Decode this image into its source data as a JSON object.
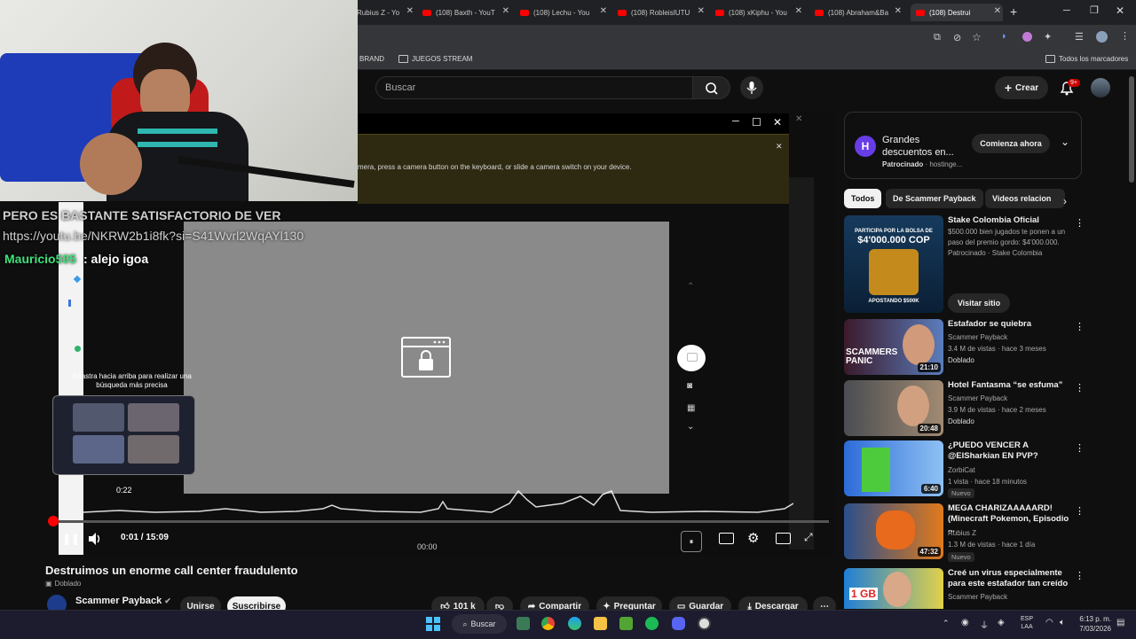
{
  "browser": {
    "tabs": [
      {
        "label": "Rubius Z - Yo",
        "active": false
      },
      {
        "label": "(108) Baxth - YouT",
        "active": false
      },
      {
        "label": "(108) Lechu - You",
        "active": false
      },
      {
        "label": "(108) RobleisIUTU",
        "active": false
      },
      {
        "label": "(108) xKiphu - You",
        "active": false
      },
      {
        "label": "(108) Abraham&Ba",
        "active": false
      },
      {
        "label": "(108) Destrui",
        "active": true
      }
    ],
    "new_tab": "+",
    "bookmarks": [
      {
        "label": "BRAND"
      },
      {
        "label": "JUEGOS STREAM"
      }
    ],
    "all_bookmarks": "Todos los marcadores"
  },
  "youtube_header": {
    "search_placeholder": "Buscar",
    "create_label": "Crear",
    "notif_badge": "9+"
  },
  "chat_overlay": {
    "line1": "PERO ES BASTANTE SATISFACTORIO DE VER",
    "line2": "https://youtu.be/NKRW2b1i8fk?si=S41Wvrl2WqAYl130",
    "user": "Mauricio505",
    "message": ": alejo igoa"
  },
  "player": {
    "camera_hint": "mera, press a camera button on the keyboard, or slide a camera switch on your device.",
    "swipe_hint": "Arrastra hacia arriba para realizar una búsqueda más precisa",
    "preview_time": "0:22",
    "time": "0:01 / 15:09",
    "waveform_time": "00:00",
    "progress_fraction": 0.001
  },
  "video": {
    "title": "Destruimos un enorme call center fraudulento",
    "dubbed": "Doblado",
    "channel": "Scammer Payback",
    "join": "Unirse",
    "subscribe": "Suscribirse",
    "likes": "101 k",
    "share": "Compartir",
    "ask": "Preguntar",
    "save": "Guardar",
    "download": "Descargar"
  },
  "ad": {
    "title": "Grandes descuentos en...",
    "sponsored": "Patrocinado",
    "advertiser": "hostinge...",
    "cta": "Comienza ahora"
  },
  "chips": [
    "Todos",
    "De Scammer Payback",
    "Videos relacion"
  ],
  "recommendations": [
    {
      "title": "Stake Colombia Oficial",
      "line1": "$500.000 bien jugados te ponen a un paso del premio gordo: $4'000.000.",
      "line2": "Patrocinado · Stake Colombia",
      "cta": "Visitar sitio",
      "thumb_text": "$4'000.000 COP",
      "thumb_sub": "PARTICIPA POR LA BOLSA DE",
      "thumb_foot": "APOSTANDO $500K",
      "duration": ""
    },
    {
      "title": "Estafador se quiebra",
      "channel": "Scammer Payback",
      "meta": "3.4 M de vistas · hace 3 meses",
      "badge": "Doblado",
      "duration": "21:10",
      "thumb_text": "SCAMMERS PANIC"
    },
    {
      "title": "Hotel Fantasma “se esfuma”",
      "channel": "Scammer Payback",
      "meta": "3.9 M de vistas · hace 2 meses",
      "badge": "Doblado",
      "duration": "20:48"
    },
    {
      "title": "¿PUEDO VENCER A @ElSharkian EN PVP?",
      "channel": "ZorbiCat",
      "meta": "1 vista · hace 18 minutos",
      "badge": "Nuevo",
      "duration": "6:40"
    },
    {
      "title": "MEGA CHARIZAAAAARD! (Minecraft Pokemon, Episodio ...",
      "channel": "Rubius Z",
      "meta": "1.3 M de vistas · hace 1 día",
      "badge": "Nuevo",
      "duration": "47:32"
    },
    {
      "title": "Creé un virus especialmente para este estafador tan creído",
      "channel": "Scammer Payback",
      "meta": "",
      "badge": "",
      "duration": "",
      "thumb_text": "1 GB"
    }
  ],
  "taskbar": {
    "search": "Buscar",
    "lang1": "ESP",
    "lang2": "LAA",
    "time": "6:13 p. m.",
    "date": "7/03/2026"
  }
}
